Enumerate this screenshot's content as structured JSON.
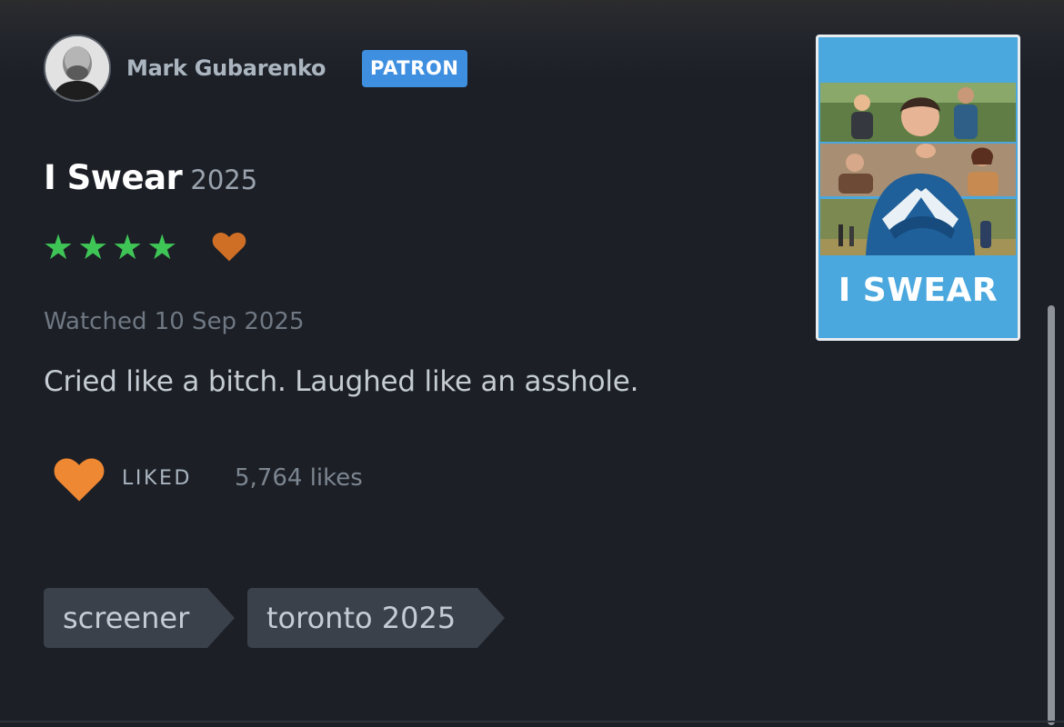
{
  "user": {
    "name": "Mark Gubarenko",
    "badge": "PATRON",
    "avatar_icon": "avatar-photo"
  },
  "film": {
    "title": "I Swear",
    "year": "2025",
    "rating_stars": 4,
    "rating_max": 5,
    "liked_heart": true,
    "poster_title": "I SWEAR"
  },
  "review": {
    "watched_text": "Watched 10 Sep 2025",
    "body": "Cried like a bitch. Laughed like an asshole."
  },
  "likes": {
    "label": "LIKED",
    "count_text": "5,764 likes"
  },
  "tags": [
    "screener",
    "toronto 2025"
  ],
  "colors": {
    "background": "#1c1f26",
    "star_green": "#3fc456",
    "heart_orange": "#ef8833",
    "badge_blue": "#3f8fe0",
    "tag_bg": "#3b414a",
    "poster_blue": "#4ba8de"
  }
}
